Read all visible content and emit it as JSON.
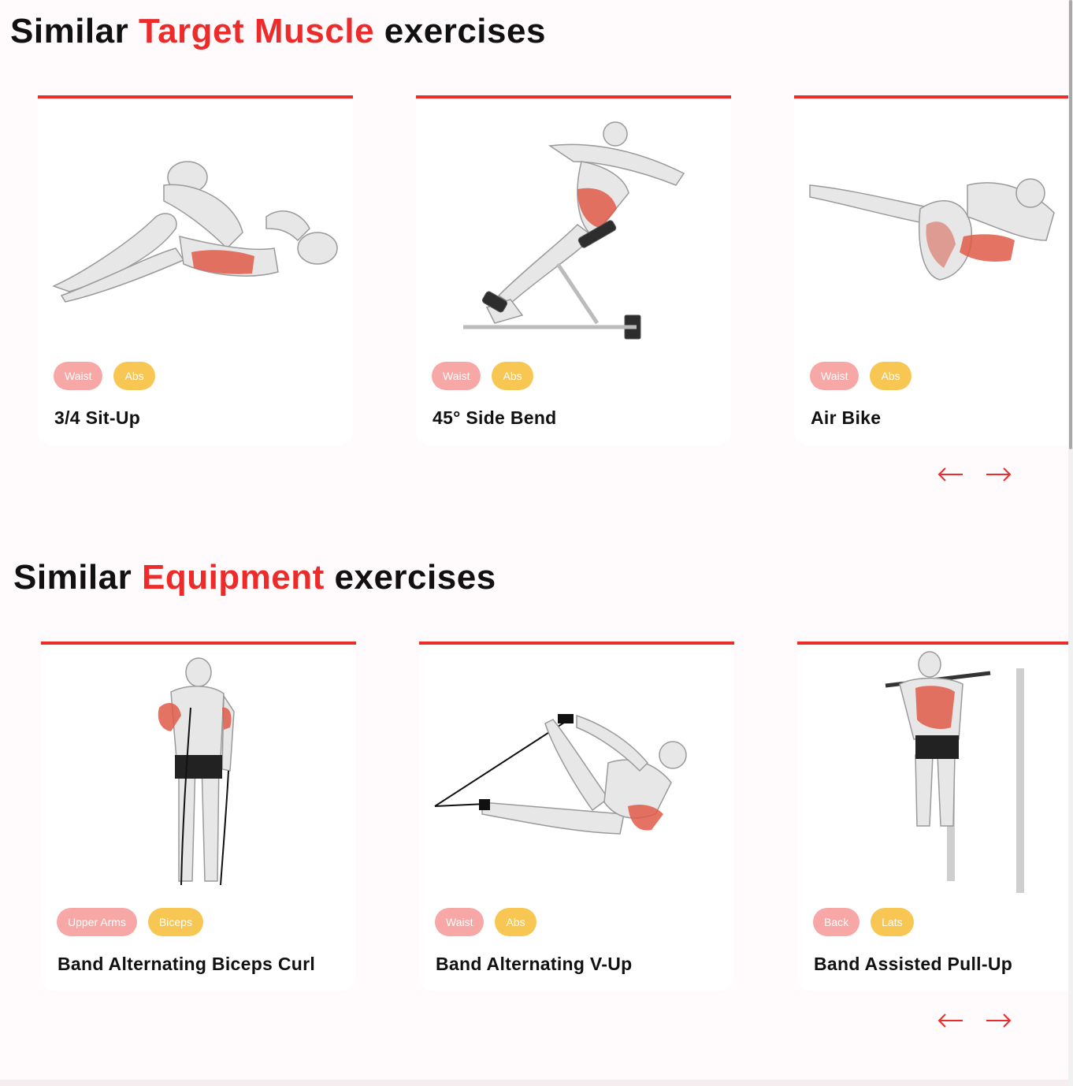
{
  "sections": [
    {
      "title_pre": "Similar ",
      "title_accent": "Target Muscle",
      "title_post": " exercises",
      "cards": [
        {
          "name": "3/4 Sit-Up",
          "tags": [
            "Waist",
            "Abs"
          ],
          "illustration": "sit-up-figure"
        },
        {
          "name": "45° Side Bend",
          "tags": [
            "Waist",
            "Abs"
          ],
          "illustration": "side-bend-bench-figure"
        },
        {
          "name": "Air Bike",
          "tags": [
            "Waist",
            "Abs"
          ],
          "illustration": "air-bike-figure"
        }
      ]
    },
    {
      "title_pre": "Similar ",
      "title_accent": "Equipment",
      "title_post": " exercises",
      "cards": [
        {
          "name": "Band Alternating Biceps Curl",
          "tags": [
            "Upper Arms",
            "Biceps"
          ],
          "illustration": "biceps-curl-band-figure"
        },
        {
          "name": "Band Alternating V-Up",
          "tags": [
            "Waist",
            "Abs"
          ],
          "illustration": "v-up-band-figure"
        },
        {
          "name": "Band Assisted Pull-Up",
          "tags": [
            "Back",
            "Lats"
          ],
          "illustration": "pull-up-bar-figure"
        }
      ]
    }
  ],
  "nav": {
    "prev_icon": "arrow-left-icon",
    "next_icon": "arrow-right-icon"
  },
  "colors": {
    "accent": "#ee2b2b",
    "tag_body_part": "#f7a8a6",
    "tag_target": "#f8c652",
    "background": "#fffafb"
  }
}
